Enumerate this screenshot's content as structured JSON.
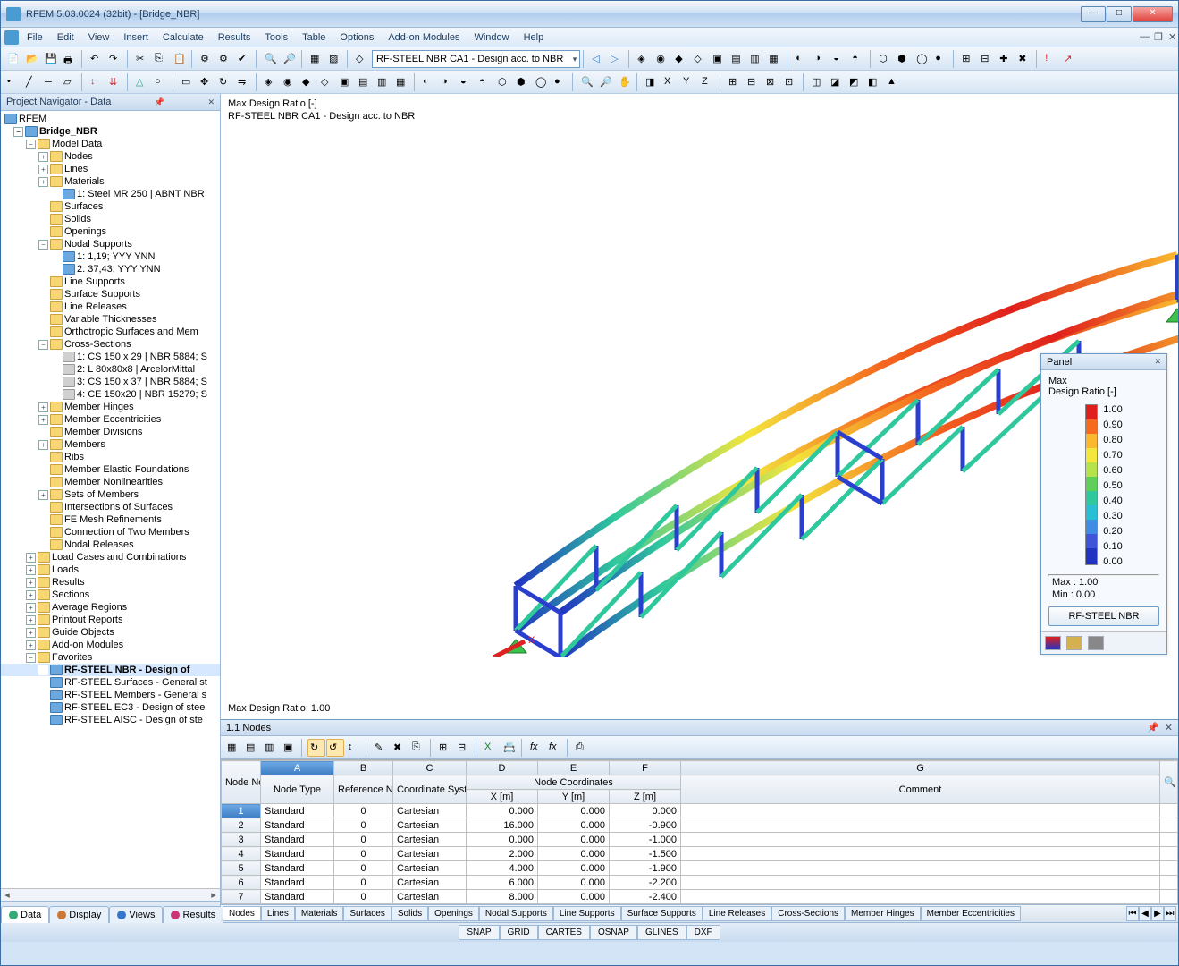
{
  "window": {
    "title": "RFEM 5.03.0024 (32bit) - [Bridge_NBR]"
  },
  "menu": [
    "File",
    "Edit",
    "View",
    "Insert",
    "Calculate",
    "Results",
    "Tools",
    "Table",
    "Options",
    "Add-on Modules",
    "Window",
    "Help"
  ],
  "combo_module": "RF-STEEL NBR CA1 - Design acc. to NBR",
  "nav": {
    "title": "Project Navigator - Data",
    "root": "RFEM",
    "project": "Bridge_NBR",
    "modelData": "Model Data",
    "items": [
      "Nodes",
      "Lines",
      "Materials"
    ],
    "material": "1: Steel MR 250 | ABNT NBR",
    "items2": [
      "Surfaces",
      "Solids",
      "Openings",
      "Nodal Supports"
    ],
    "supports": [
      "1: 1,19; YYY YNN",
      "2: 37,43; YYY YNN"
    ],
    "items3": [
      "Line Supports",
      "Surface Supports",
      "Line Releases",
      "Variable Thicknesses",
      "Orthotropic Surfaces and Mem",
      "Cross-Sections"
    ],
    "cross": [
      "1: CS 150 x 29 | NBR 5884; S",
      "2: L 80x80x8 | ArcelorMittal",
      "3: CS 150 x 37 | NBR 5884; S",
      "4: CE 150x20 | NBR 15279; S"
    ],
    "items4": [
      "Member Hinges",
      "Member Eccentricities",
      "Member Divisions",
      "Members",
      "Ribs",
      "Member Elastic Foundations",
      "Member Nonlinearities",
      "Sets of Members",
      "Intersections of Surfaces",
      "FE Mesh Refinements",
      "Connection of Two Members",
      "Nodal Releases"
    ],
    "items5": [
      "Load Cases and Combinations",
      "Loads",
      "Results",
      "Sections",
      "Average Regions",
      "Printout Reports",
      "Guide Objects",
      "Add-on Modules",
      "Favorites"
    ],
    "fav": [
      "RF-STEEL NBR - Design of",
      "RF-STEEL Surfaces - General st",
      "RF-STEEL Members - General s",
      "RF-STEEL EC3 - Design of stee",
      "RF-STEEL AISC - Design of ste"
    ]
  },
  "navtabs": [
    "Data",
    "Display",
    "Views",
    "Results"
  ],
  "view": {
    "line1": "Max Design Ratio [-]",
    "line2": "RF-STEEL NBR CA1 - Design acc. to NBR",
    "footer": "Max Design Ratio: 1.00"
  },
  "panel": {
    "title": "Panel",
    "sub1": "Max",
    "sub2": "Design Ratio [-]",
    "scale": [
      "1.00",
      "0.90",
      "0.80",
      "0.70",
      "0.60",
      "0.50",
      "0.40",
      "0.30",
      "0.20",
      "0.10",
      "0.00"
    ],
    "max": "Max  :   1.00",
    "min": "Min   :   0.00",
    "btn": "RF-STEEL NBR"
  },
  "table": {
    "title": "1.1 Nodes",
    "letters": [
      "A",
      "B",
      "C",
      "D",
      "E",
      "F",
      "G"
    ],
    "h1": [
      "Node\nNo.",
      "Node Type",
      "Reference\nNode",
      "Coordinate\nSystem",
      "Node Coordinates",
      "Comment"
    ],
    "sub": [
      "X [m]",
      "Y [m]",
      "Z [m]"
    ],
    "rows": [
      {
        "no": "1",
        "type": "Standard",
        "ref": "0",
        "cs": "Cartesian",
        "x": "0.000",
        "y": "0.000",
        "z": "0.000"
      },
      {
        "no": "2",
        "type": "Standard",
        "ref": "0",
        "cs": "Cartesian",
        "x": "16.000",
        "y": "0.000",
        "z": "-0.900"
      },
      {
        "no": "3",
        "type": "Standard",
        "ref": "0",
        "cs": "Cartesian",
        "x": "0.000",
        "y": "0.000",
        "z": "-1.000"
      },
      {
        "no": "4",
        "type": "Standard",
        "ref": "0",
        "cs": "Cartesian",
        "x": "2.000",
        "y": "0.000",
        "z": "-1.500"
      },
      {
        "no": "5",
        "type": "Standard",
        "ref": "0",
        "cs": "Cartesian",
        "x": "4.000",
        "y": "0.000",
        "z": "-1.900"
      },
      {
        "no": "6",
        "type": "Standard",
        "ref": "0",
        "cs": "Cartesian",
        "x": "6.000",
        "y": "0.000",
        "z": "-2.200"
      },
      {
        "no": "7",
        "type": "Standard",
        "ref": "0",
        "cs": "Cartesian",
        "x": "8.000",
        "y": "0.000",
        "z": "-2.400"
      }
    ]
  },
  "btTabs": [
    "Nodes",
    "Lines",
    "Materials",
    "Surfaces",
    "Solids",
    "Openings",
    "Nodal Supports",
    "Line Supports",
    "Surface Supports",
    "Line Releases",
    "Cross-Sections",
    "Member Hinges",
    "Member Eccentricities"
  ],
  "status": [
    "SNAP",
    "GRID",
    "CARTES",
    "OSNAP",
    "GLINES",
    "DXF"
  ]
}
